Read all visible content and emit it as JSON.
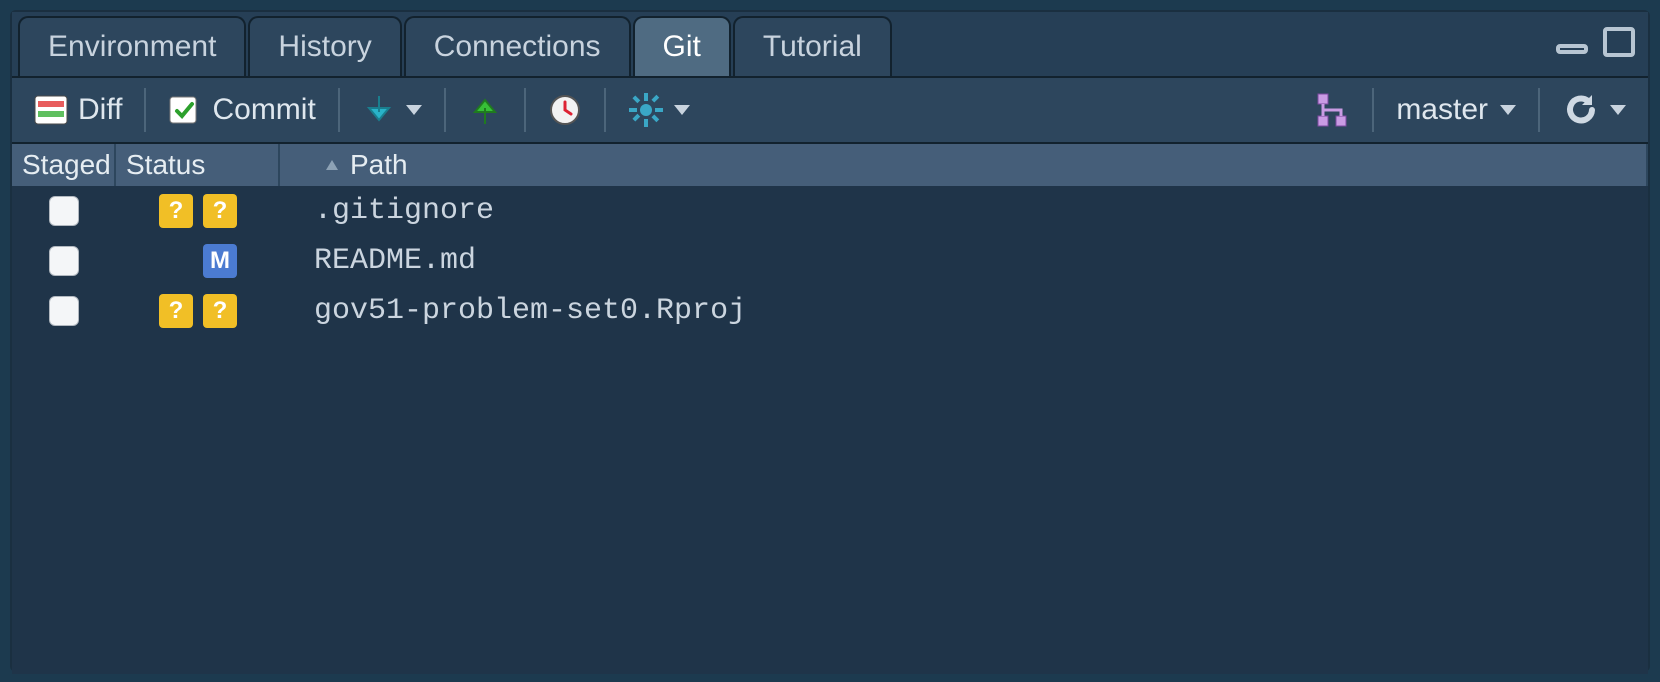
{
  "tabs": [
    {
      "label": "Environment",
      "active": false
    },
    {
      "label": "History",
      "active": false
    },
    {
      "label": "Connections",
      "active": false
    },
    {
      "label": "Git",
      "active": true
    },
    {
      "label": "Tutorial",
      "active": false
    }
  ],
  "toolbar": {
    "diff_label": "Diff",
    "commit_label": "Commit",
    "branch_label": "master"
  },
  "columns": {
    "staged": "Staged",
    "status": "Status",
    "path": "Path"
  },
  "rows": [
    {
      "staged": false,
      "status": {
        "staged": "?",
        "unstaged": "?",
        "kind": "unknown"
      },
      "path": ".gitignore"
    },
    {
      "staged": false,
      "status": {
        "staged": "",
        "unstaged": "M",
        "kind": "modified"
      },
      "path": "README.md"
    },
    {
      "staged": false,
      "status": {
        "staged": "?",
        "unstaged": "?",
        "kind": "unknown"
      },
      "path": "gov51-problem-set0.Rproj"
    }
  ]
}
